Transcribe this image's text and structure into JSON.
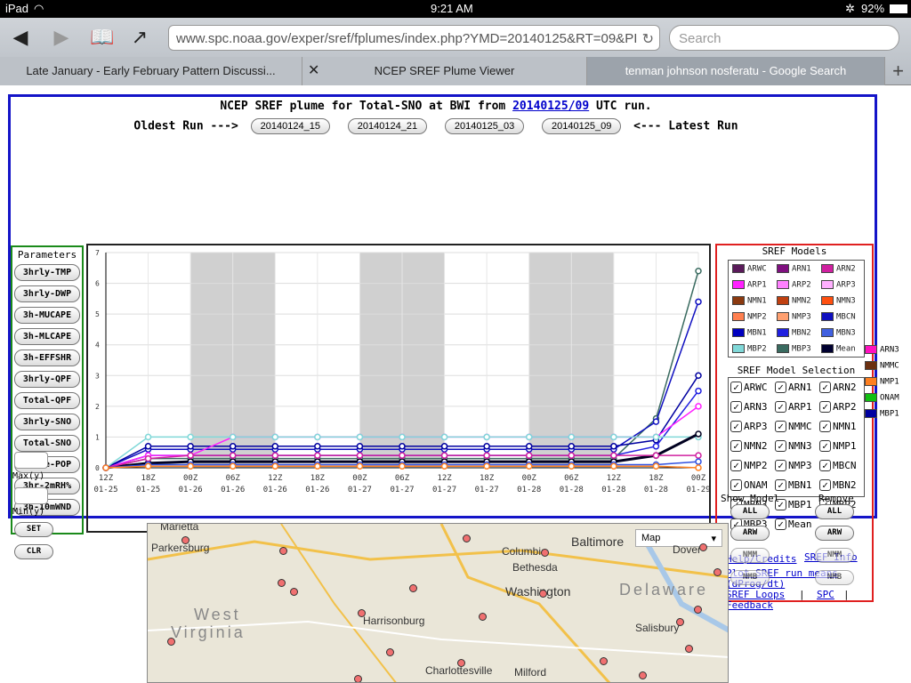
{
  "status": {
    "device": "iPad",
    "time": "9:21 AM",
    "battery": "92%"
  },
  "browser": {
    "url": "www.spc.noaa.gov/exper/sref/fplumes/index.php?YMD=20140125&RT=09&PI",
    "search_placeholder": "Search",
    "tabs": [
      {
        "label": "Late January - Early February Pattern Discussi..."
      },
      {
        "label": "NCEP SREF Plume Viewer"
      },
      {
        "label": "tenman johnson nosferatu - Google Search"
      }
    ]
  },
  "page": {
    "title_prefix": "NCEP SREF plume for Total-SNO at BWI from",
    "run_link": "20140125/09",
    "title_suffix": "UTC run.",
    "oldest_label": "Oldest Run --->",
    "latest_label": "<--- Latest Run",
    "runs": [
      "20140124_15",
      "20140124_21",
      "20140125_03",
      "20140125_09"
    ]
  },
  "params": {
    "header": "Parameters",
    "buttons": [
      "3hrly-TMP",
      "3hrly-DWP",
      "3h-MUCAPE",
      "3h-MLCAPE",
      "3h-EFFSHR",
      "3hrly-QPF",
      "Total-QPF",
      "3hrly-SNO",
      "Total-SNO",
      "Ptype-POP",
      "3hr-2mRH%",
      "3h-10mWND"
    ],
    "max_label": "Max(y)",
    "min_label": "Min(y)",
    "set_label": "SET",
    "clr_label": "CLR"
  },
  "chart_data": {
    "type": "line",
    "title": "",
    "xlabel": "",
    "ylabel": "",
    "ylim": [
      0,
      7
    ],
    "x": [
      "12Z 01-25",
      "18Z 01-25",
      "00Z 01-26",
      "06Z 01-26",
      "12Z 01-26",
      "18Z 01-26",
      "00Z 01-27",
      "06Z 01-27",
      "12Z 01-27",
      "18Z 01-27",
      "00Z 01-28",
      "06Z 01-28",
      "12Z 01-28",
      "18Z 01-28",
      "00Z 01-29"
    ],
    "series": [
      {
        "name": "MBP3",
        "color": "#3a6b60",
        "values": [
          0,
          0.3,
          0.3,
          0.3,
          0.3,
          0.3,
          0.3,
          0.3,
          0.3,
          0.3,
          0.3,
          0.3,
          0.3,
          1.6,
          6.4
        ]
      },
      {
        "name": "MBCN",
        "color": "#1010c0",
        "values": [
          0,
          0.6,
          0.6,
          0.6,
          0.6,
          0.6,
          0.6,
          0.6,
          0.6,
          0.6,
          0.6,
          0.6,
          0.6,
          1.5,
          5.4
        ]
      },
      {
        "name": "MBN1",
        "color": "#0000a0",
        "values": [
          0,
          0.7,
          0.7,
          0.7,
          0.7,
          0.7,
          0.7,
          0.7,
          0.7,
          0.7,
          0.7,
          0.7,
          0.7,
          0.9,
          3.0
        ]
      },
      {
        "name": "MBN2",
        "color": "#2020e0",
        "values": [
          0,
          0.4,
          0.4,
          0.4,
          0.4,
          0.4,
          0.4,
          0.4,
          0.4,
          0.4,
          0.4,
          0.4,
          0.4,
          0.7,
          2.5
        ]
      },
      {
        "name": "ARP1",
        "color": "#ff20ff",
        "values": [
          0,
          0.4,
          0.4,
          1.0,
          1.0,
          1.0,
          1.0,
          1.0,
          1.0,
          1.0,
          1.0,
          1.0,
          1.0,
          1.0,
          2.0
        ]
      },
      {
        "name": "MBP2",
        "color": "#80d8d8",
        "values": [
          0,
          1.0,
          1.0,
          1.0,
          1.0,
          1.0,
          1.0,
          1.0,
          1.0,
          1.0,
          1.0,
          1.0,
          1.0,
          1.0,
          1.0
        ]
      },
      {
        "name": "Mean",
        "color": "#000020",
        "values": [
          0,
          0.15,
          0.2,
          0.2,
          0.2,
          0.2,
          0.2,
          0.2,
          0.2,
          0.2,
          0.2,
          0.2,
          0.2,
          0.4,
          1.1
        ]
      },
      {
        "name": "ARN2",
        "color": "#d020a0",
        "values": [
          0,
          0.3,
          0.4,
          0.4,
          0.4,
          0.4,
          0.4,
          0.4,
          0.4,
          0.4,
          0.4,
          0.4,
          0.4,
          0.4,
          0.4
        ]
      },
      {
        "name": "MBN3",
        "color": "#3050e0",
        "values": [
          0,
          0.1,
          0.1,
          0.1,
          0.1,
          0.1,
          0.1,
          0.1,
          0.1,
          0.1,
          0.1,
          0.1,
          0.1,
          0.1,
          0.2
        ]
      },
      {
        "name": "NMP1",
        "color": "#ff8020",
        "values": [
          0,
          0.05,
          0.05,
          0.05,
          0.05,
          0.05,
          0.05,
          0.05,
          0.05,
          0.05,
          0.05,
          0.05,
          0.05,
          0.05,
          0
        ]
      }
    ]
  },
  "models": {
    "header": "SREF Models",
    "entries": [
      {
        "name": "ARWC",
        "color": "#5a1a5a"
      },
      {
        "name": "ARN1",
        "color": "#801080"
      },
      {
        "name": "ARN2",
        "color": "#d020a0"
      },
      {
        "name": "ARP1",
        "color": "#ff20ff"
      },
      {
        "name": "ARP2",
        "color": "#ff80ff"
      },
      {
        "name": "ARP3",
        "color": "#ffb0ff"
      },
      {
        "name": "NMN1",
        "color": "#8b3a10"
      },
      {
        "name": "NMN2",
        "color": "#c04010"
      },
      {
        "name": "NMN3",
        "color": "#ff5010"
      },
      {
        "name": "NMP2",
        "color": "#ff8050"
      },
      {
        "name": "NMP3",
        "color": "#ffa070"
      },
      {
        "name": "MBCN",
        "color": "#1010c0"
      },
      {
        "name": "MBN1",
        "color": "#0000c0"
      },
      {
        "name": "MBN2",
        "color": "#2020e0"
      },
      {
        "name": "MBN3",
        "color": "#4060e0"
      },
      {
        "name": "MBP2",
        "color": "#80d8d8"
      },
      {
        "name": "MBP3",
        "color": "#3a6b60"
      },
      {
        "name": "Mean",
        "color": "#000030"
      }
    ],
    "extra": [
      {
        "name": "ARN3",
        "color": "#ff10c0"
      },
      {
        "name": "NMMC",
        "color": "#6b3010"
      },
      {
        "name": "NMP1",
        "color": "#ff8020"
      },
      {
        "name": "ONAM",
        "color": "#10c010"
      },
      {
        "name": "MBP1",
        "color": "#0000a0"
      }
    ]
  },
  "selection": {
    "header": "SREF Model Selection",
    "items": [
      "ARWC",
      "ARN1",
      "ARN2",
      "ARN3",
      "ARP1",
      "ARP2",
      "ARP3",
      "NMMC",
      "NMN1",
      "NMN2",
      "NMN3",
      "NMP1",
      "NMP2",
      "NMP3",
      "MBCN",
      "ONAM",
      "MBN1",
      "MBN2",
      "MBN3",
      "MBP1",
      "MBP2",
      "MBP3",
      "Mean"
    ],
    "show_label": "Show Model",
    "remove_label": "Remove",
    "btns": [
      "ALL",
      "ARW",
      "NMM",
      "NMB"
    ]
  },
  "links": {
    "help": "Help/Credits",
    "info": "SREF Info",
    "plot": "Plot SREF run means",
    "dprog": "(dProg/dt)",
    "loops": "SREF Loops",
    "spc": "SPC",
    "feedback": "Feedback"
  },
  "map": {
    "type_label": "Map",
    "labels": [
      "Marietta",
      "Parkersburg",
      "Baltimore",
      "Columbia",
      "Bethesda",
      "Washington",
      "Dover",
      "Delaware",
      "West",
      "Virginia",
      "Harrisonburg",
      "Salisbury",
      "Charlottesville",
      "Milford"
    ]
  }
}
